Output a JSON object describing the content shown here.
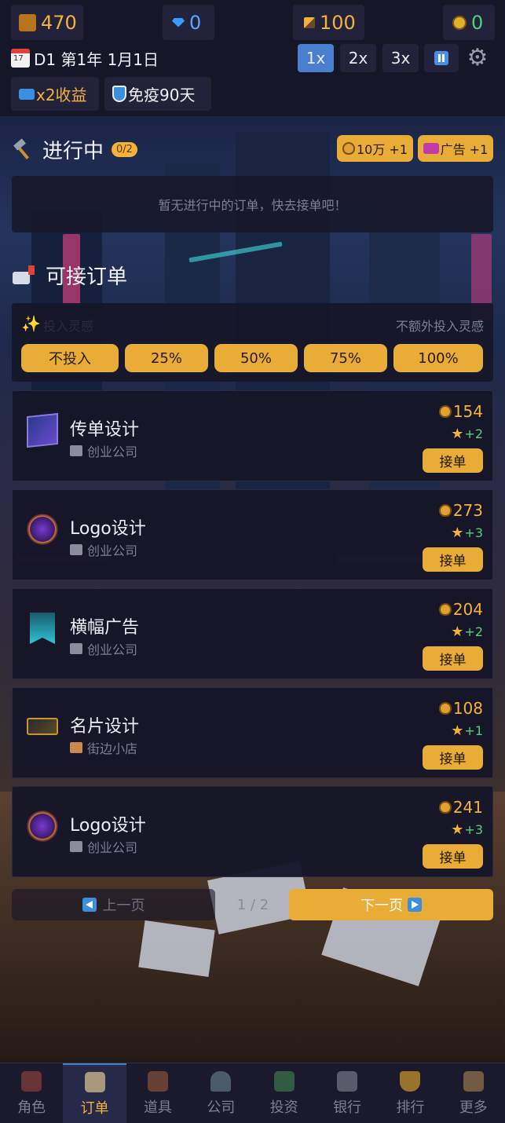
{
  "resources": {
    "gold": "470",
    "gems": "0",
    "inspiration": "100",
    "coins": "0"
  },
  "date": "D1 第1年 1月1日",
  "speed": {
    "options": [
      "1x",
      "2x",
      "3x"
    ],
    "selected": "1x"
  },
  "buffs": {
    "income": "x2收益",
    "immunity": "免疫90天"
  },
  "in_progress": {
    "title": "进行中",
    "count": "0/2",
    "ad_money": "10万 +1",
    "ad_slot": "广告 +1",
    "empty_text": "暂无进行中的订单，快去接单吧！"
  },
  "available": {
    "title": "可接订单",
    "invest_label": "投入灵感",
    "invest_hint": "不额外投入灵感",
    "invest_options": [
      "不投入",
      "25%",
      "50%",
      "75%",
      "100%"
    ]
  },
  "orders": [
    {
      "name": "传单设计",
      "client": "创业公司",
      "reward": "154",
      "xp": "+2",
      "accept": "接单",
      "icon": "flyer-icon"
    },
    {
      "name": "Logo设计",
      "client": "创业公司",
      "reward": "273",
      "xp": "+3",
      "accept": "接单",
      "icon": "logo-icon"
    },
    {
      "name": "横幅广告",
      "client": "创业公司",
      "reward": "204",
      "xp": "+2",
      "accept": "接单",
      "icon": "banner-icon"
    },
    {
      "name": "名片设计",
      "client": "街边小店",
      "reward": "108",
      "xp": "+1",
      "accept": "接单",
      "icon": "business-card-icon"
    },
    {
      "name": "Logo设计",
      "client": "创业公司",
      "reward": "241",
      "xp": "+3",
      "accept": "接单",
      "icon": "logo-icon"
    }
  ],
  "pagination": {
    "prev": "上一页",
    "info": "1 / 2",
    "next": "下一页"
  },
  "nav": [
    {
      "label": "角色",
      "icon": "character-icon"
    },
    {
      "label": "订单",
      "icon": "orders-icon"
    },
    {
      "label": "道具",
      "icon": "items-icon"
    },
    {
      "label": "公司",
      "icon": "company-icon"
    },
    {
      "label": "投资",
      "icon": "invest-icon"
    },
    {
      "label": "银行",
      "icon": "bank-icon"
    },
    {
      "label": "排行",
      "icon": "trophy-icon"
    },
    {
      "label": "更多",
      "icon": "more-icon"
    }
  ],
  "nav_active": "订单",
  "colors": {
    "accent_gold": "#e9ad37",
    "accent_blue": "#4a7fd0",
    "xp_green": "#4fd27c"
  }
}
